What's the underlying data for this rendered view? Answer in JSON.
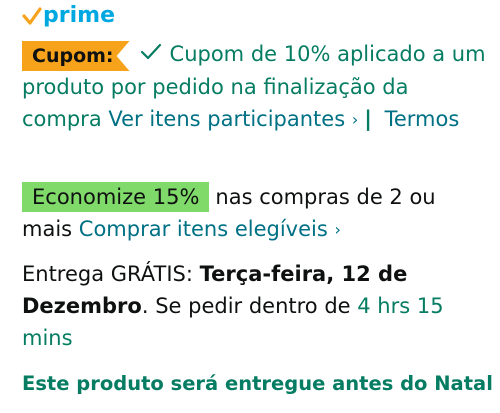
{
  "prime": {
    "logo_text": "prime",
    "check_color": "#f7a21b",
    "text_color": "#00a8e1"
  },
  "coupon": {
    "badge_label": "Cupom:",
    "message": "Cupom de 10% aplicado a um produto por pedido na finalização da compra",
    "participants_link": "Ver itens participantes",
    "chevron": "›",
    "separator": "|",
    "terms_link": "Termos",
    "badge_color": "#f7a21b",
    "text_color": "#067d62"
  },
  "savings": {
    "badge_label": "Economize 15%",
    "message": "nas compras de 2 ou mais",
    "link": "Comprar itens elegíveis",
    "chevron": "›",
    "badge_color": "#7fda69"
  },
  "delivery": {
    "prefix": "Entrega GRÁTIS: ",
    "date": "Terça-feira, 12 de Dezembro",
    "middle": ". Se pedir dentro de ",
    "countdown": "4 hrs 15 mins"
  },
  "christmas": {
    "message": "Este produto será entregue antes do Natal"
  }
}
